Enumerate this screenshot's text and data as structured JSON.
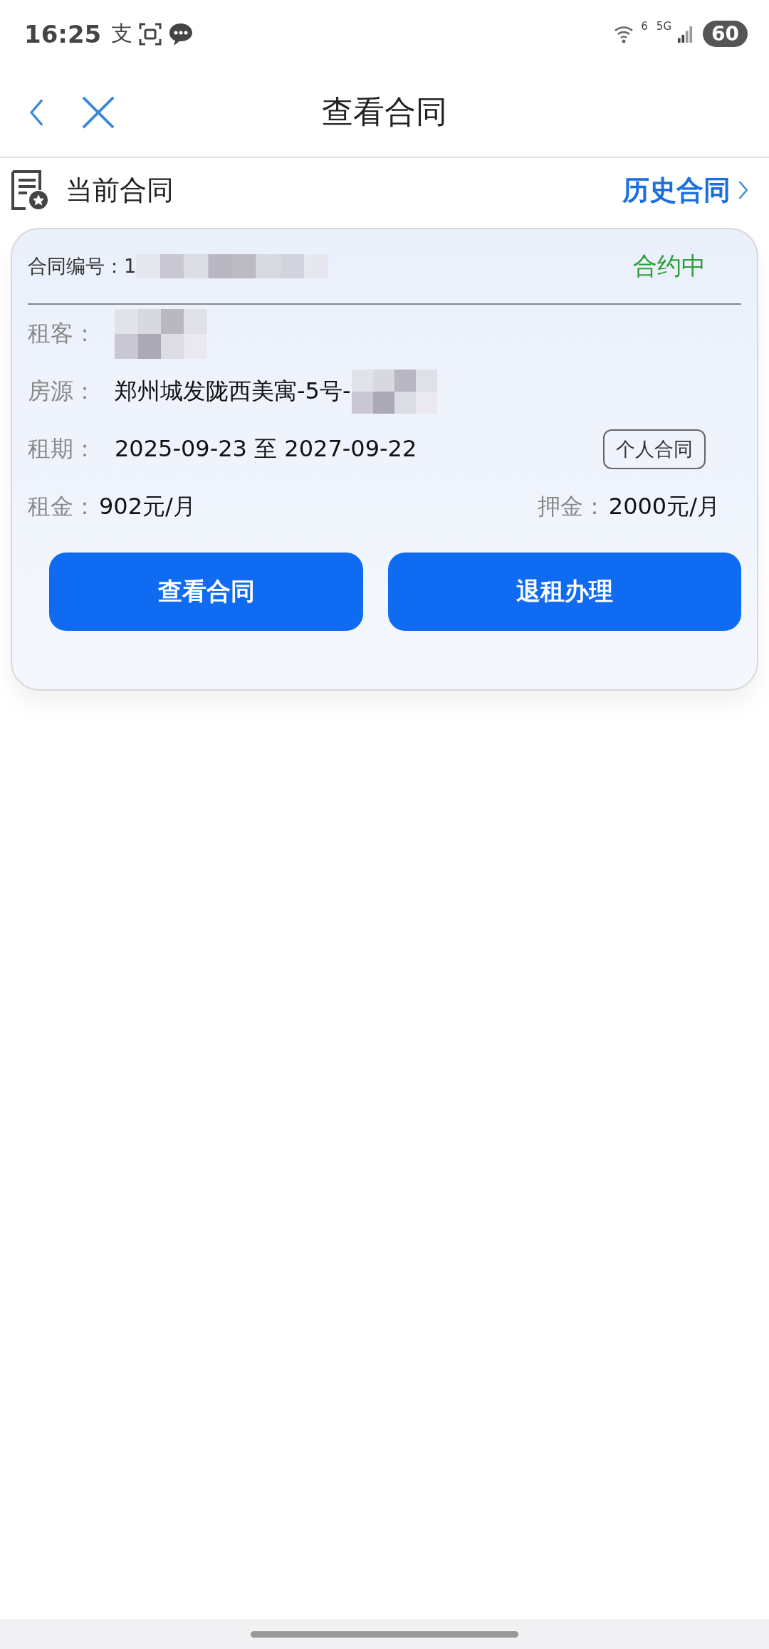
{
  "status_bar": {
    "time": "16:25",
    "notification_glyph": "支",
    "wifi_label": "6",
    "network": "5G",
    "battery": "60"
  },
  "header": {
    "title": "查看合同"
  },
  "section": {
    "title": "当前合同",
    "link": "历史合同"
  },
  "contract": {
    "number_label": "合同编号：",
    "number": "1",
    "status": "合约中",
    "fields": [
      {
        "label": "租客："
      },
      {
        "label": "房源：",
        "value": "郑州城发陇西美寓-5号-"
      },
      {
        "label": "租期：",
        "value": "2025-09-23 至 2027-09-22"
      }
    ],
    "tag": "个人合同",
    "rent": {
      "label": "租金：",
      "value": "902元/月"
    },
    "deposit": {
      "label": "押金：",
      "value": "2000元/月"
    },
    "buttons": [
      "查看合同",
      "退租办理"
    ]
  }
}
